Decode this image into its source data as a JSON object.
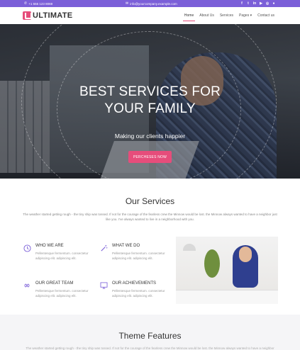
{
  "topbar": {
    "phone": "+1 555 123 8069",
    "email": "info@yourcompany.example.com",
    "social_icons": [
      "facebook-icon",
      "twitter-icon",
      "linkedin-icon",
      "youtube-icon",
      "instagram-icon",
      "github-icon"
    ]
  },
  "nav": {
    "logo_text": "ULTIMATE",
    "items": [
      {
        "label": "Home",
        "active": true
      },
      {
        "label": "About Us",
        "active": false
      },
      {
        "label": "Services",
        "active": false
      },
      {
        "label": "Pages ▾",
        "active": false
      },
      {
        "label": "Contact us",
        "active": false
      }
    ]
  },
  "hero": {
    "title_line1": "BEST SERVICES FOR",
    "title_line2": "YOUR FAMILY",
    "subtitle": "Making our clients happier",
    "cta_label": "PERCHESES NOW"
  },
  "services": {
    "title": "Our Services",
    "description": "The weather started getting rough - the tiny ship was tossed. If not for the courage of the fearless crew the Minnow would be lost. the Minnow always wanted to have a neighbor just like you. I've always wanted to live in a neighborhood with you.",
    "features": [
      {
        "icon": "clock-icon",
        "title": "WHO WE ARE",
        "desc": "Pellentesque fermentum. consectetur adipiscing elit. adipiscing elit."
      },
      {
        "icon": "magic-wand-icon",
        "title": "WHAT WE DO",
        "desc": "Pellentesque fermentum. consectetur adipiscing elit. adipiscing elit."
      },
      {
        "icon": "infinity-icon",
        "title": "OUR GREAT TEAM",
        "desc": "Pellentesque fermentum. consectetur adipiscing elit. adipiscing elit."
      },
      {
        "icon": "monitor-icon",
        "title": "OUR ACHIEVEMENTS",
        "desc": "Pellentesque fermentum. consectetur adipiscing elit. adipiscing elit."
      }
    ]
  },
  "theme": {
    "title": "Theme Features",
    "description": "The weather started getting rough - the tiny ship was tossed. If not for the courage of the fearless crew the Minnow would be lost. the Minnow always wanted to have a neighbor"
  },
  "colors": {
    "accent": "#7b5fd8",
    "brand_pink": "#e64d7b"
  }
}
